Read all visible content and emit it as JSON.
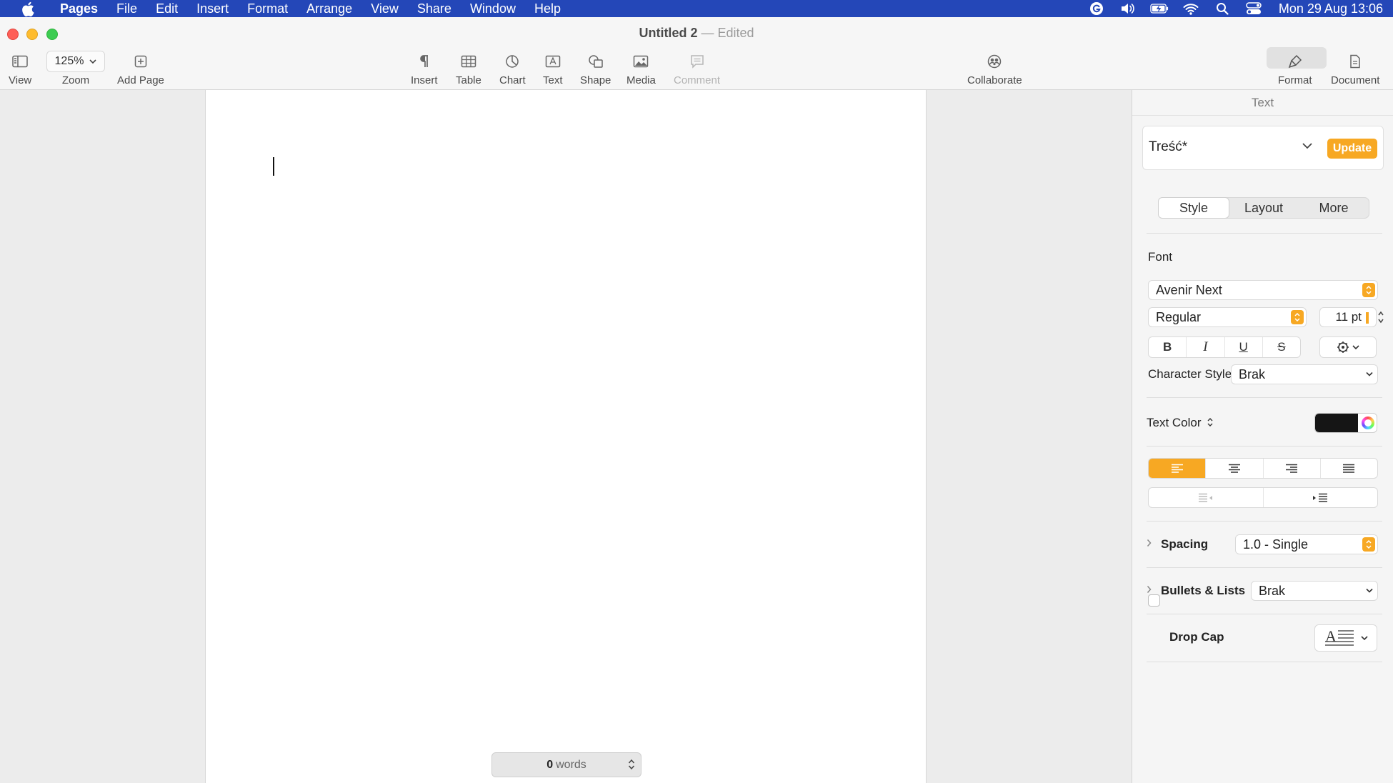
{
  "menubar": {
    "app_name": "Pages",
    "items": [
      "File",
      "Edit",
      "Insert",
      "Format",
      "Arrange",
      "View",
      "Share",
      "Window",
      "Help"
    ],
    "clock": "Mon 29 Aug  13:06"
  },
  "window": {
    "doc_name": "Untitled 2",
    "sep": "—",
    "status": "Edited"
  },
  "toolbar": {
    "view": "View",
    "zoom_value": "125%",
    "zoom": "Zoom",
    "add_page": "Add Page",
    "insert": "Insert",
    "table": "Table",
    "chart": "Chart",
    "text": "Text",
    "shape": "Shape",
    "media": "Media",
    "comment": "Comment",
    "collaborate": "Collaborate",
    "format": "Format",
    "document": "Document"
  },
  "document": {
    "word_count": "0",
    "word_unit": "words"
  },
  "inspector": {
    "header": "Text",
    "paragraph_style": "Treść*",
    "update_label": "Update",
    "tabs": [
      "Style",
      "Layout",
      "More"
    ],
    "font_label": "Font",
    "font_family": "Avenir Next",
    "font_weight": "Regular",
    "font_size": "11 pt",
    "bold": "B",
    "italic": "I",
    "underline": "U",
    "strike": "S",
    "char_styles_label": "Character Styles",
    "char_styles_value": "Brak",
    "text_color_label": "Text Color",
    "text_color": "#151515",
    "spacing_label": "Spacing",
    "spacing_value": "1.0 - Single",
    "bullets_label": "Bullets & Lists",
    "bullets_value": "Brak",
    "dropcap_label": "Drop Cap",
    "accent": "#f7a823"
  }
}
